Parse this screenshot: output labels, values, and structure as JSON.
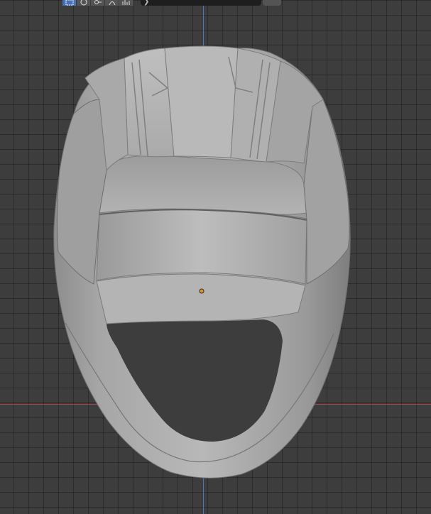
{
  "viewport": {
    "background": "#3d3d3d",
    "grid": true,
    "axis_colors": {
      "x": "#c0404a",
      "y": "#4a7ec4"
    },
    "origin_color": "#e8902a",
    "model_description_icon": "helmet-mesh"
  },
  "toolbar": {
    "tools": [
      {
        "name": "select-box-icon",
        "active": true
      },
      {
        "name": "viewport-shading-icon",
        "active": false
      },
      {
        "name": "transform-pivot-icon",
        "active": false
      },
      {
        "name": "snap-icon",
        "active": false
      },
      {
        "name": "proportional-edit-icon",
        "active": false
      }
    ],
    "path_glyph": "❯"
  }
}
